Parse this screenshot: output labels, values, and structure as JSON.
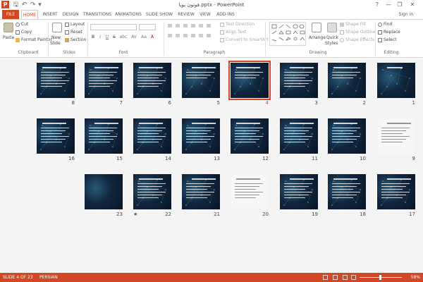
{
  "window": {
    "title": "فوتون پویا.pptx - PowerPoint",
    "app_icon": "P",
    "help_glyph": "?",
    "minimize_glyph": "—",
    "restore_glyph": "❐",
    "close_glyph": "✕"
  },
  "qat": {
    "save": "🖫",
    "undo": "↶",
    "redo": "↷",
    "customize": "▾"
  },
  "tabs": {
    "file": "FILE",
    "items": [
      "HOME",
      "INSERT",
      "DESIGN",
      "TRANSITIONS",
      "ANIMATIONS",
      "SLIDE SHOW",
      "REVIEW",
      "VIEW",
      "ADD-INS"
    ],
    "active": "HOME",
    "signin": "Sign in"
  },
  "ribbon": {
    "clipboard": {
      "paste": "Paste",
      "cut": "Cut",
      "copy": "Copy",
      "format_painter": "Format Painter",
      "label": "Clipboard"
    },
    "slides": {
      "new_slide": "New",
      "new_slide2": "Slide",
      "layout": "Layout",
      "reset": "Reset",
      "section": "Section",
      "label": "Slides"
    },
    "font": {
      "label": "Font",
      "bold": "B",
      "italic": "I",
      "underline": "U",
      "strike": "S",
      "shadow": "abc",
      "spacing": "AV",
      "case": "Aa",
      "color": "A"
    },
    "paragraph": {
      "label": "Paragraph",
      "text_direction": "Text Direction",
      "align_text": "Align Text",
      "convert_smartart": "Convert to SmartArt"
    },
    "drawing": {
      "label": "Drawing",
      "arrange": "Arrange",
      "quick_styles": "Quick",
      "quick_styles2": "Styles",
      "shape_fill": "Shape Fill",
      "shape_outline": "Shape Outline",
      "shape_effects": "Shape Effects"
    },
    "editing": {
      "label": "Editing",
      "find": "Find",
      "replace": "Replace",
      "select": "Select"
    }
  },
  "slides": {
    "count": 23,
    "current": 4,
    "numbers": [
      "1",
      "2",
      "3",
      "4",
      "5",
      "6",
      "7",
      "8",
      "9",
      "10",
      "11",
      "12",
      "13",
      "14",
      "15",
      "16",
      "17",
      "18",
      "19",
      "20",
      "21",
      "22",
      "23"
    ],
    "star_mark": "★"
  },
  "status": {
    "slide_label": "SLIDE 4 OF 23",
    "language": "PERSIAN",
    "zoom": "58%"
  },
  "colors": {
    "accent": "#d24726",
    "slide_bg": "#0d1f34"
  }
}
